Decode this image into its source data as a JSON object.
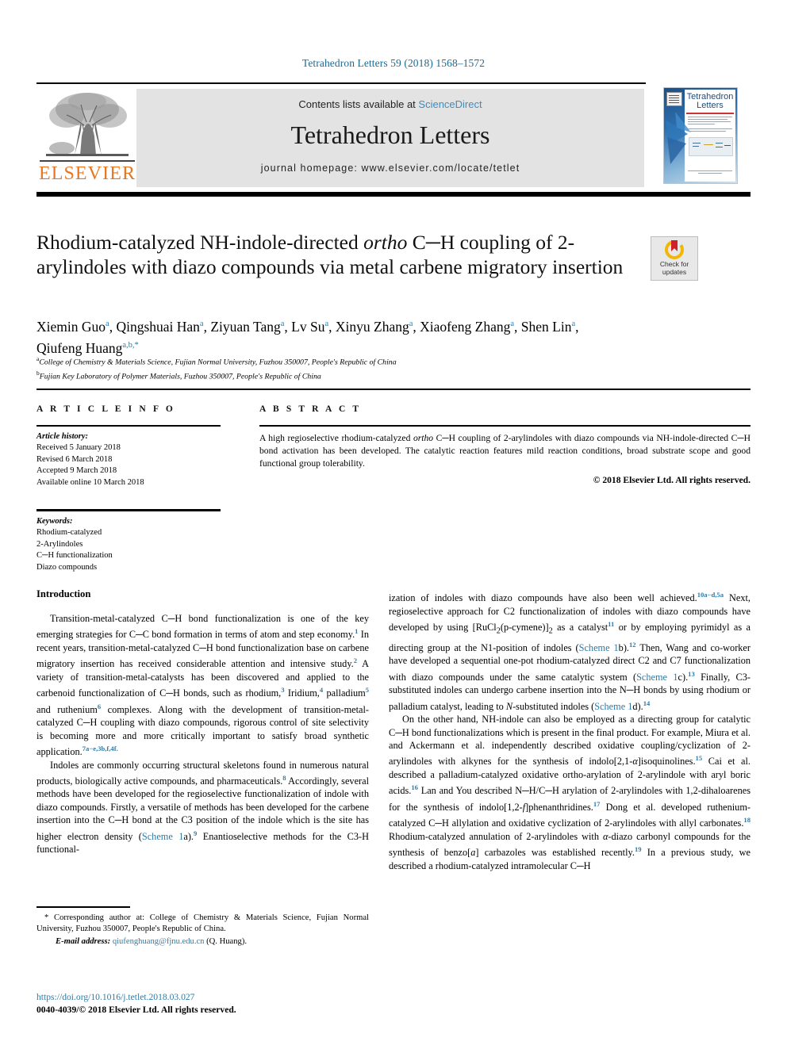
{
  "running_head": "Tetrahedron Letters 59 (2018) 1568–1572",
  "masthead": {
    "contents_prefix": "Contents lists available at ",
    "sciencedirect": "ScienceDirect",
    "journal_name": "Tetrahedron Letters",
    "homepage": "journal homepage: www.elsevier.com/locate/tetlet",
    "publisher": "ELSEVIER",
    "cover_title": "Tetrahedron Letters"
  },
  "crossmark": {
    "line1": "Check for",
    "line2": "updates"
  },
  "title": {
    "line1_a": "Rhodium-catalyzed NH-indole-directed ",
    "line1_italic": "ortho",
    "line1_b": " C─H coupling of",
    "line2": "2-arylindoles with diazo compounds via metal carbene migratory",
    "line3": "insertion"
  },
  "authors": {
    "list": [
      {
        "name": "Xiemin Guo",
        "sup": "a"
      },
      {
        "name": "Qingshuai Han",
        "sup": "a"
      },
      {
        "name": "Ziyuan Tang",
        "sup": "a"
      },
      {
        "name": "Lv Su",
        "sup": "a"
      },
      {
        "name": "Xinyu Zhang",
        "sup": "a"
      },
      {
        "name": "Xiaofeng Zhang",
        "sup": "a"
      },
      {
        "name": "Shen Lin",
        "sup": "a"
      },
      {
        "name": "Qiufeng Huang",
        "sup": "a,b,*"
      }
    ],
    "affiliation_a": "College of Chemistry & Materials Science, Fujian Normal University, Fuzhou 350007, People's Republic of China",
    "affiliation_b": "Fujian Key Laboratory of Polymer Materials, Fuzhou 350007, People's Republic of China",
    "affiliation_a_mark": "a",
    "affiliation_b_mark": "b"
  },
  "sections": {
    "article_info_header": "A R T I C L E   I N F O",
    "abstract_header": "A B S T R A C T"
  },
  "article_info": {
    "history_title": "Article history:",
    "history": [
      "Received 5 January 2018",
      "Revised 6 March 2018",
      "Accepted 9 March 2018",
      "Available online 10 March 2018"
    ],
    "keywords_title": "Keywords:",
    "keywords": [
      "Rhodium-catalyzed",
      "2-Arylindoles",
      "C─H functionalization",
      "Diazo compounds"
    ]
  },
  "abstract": {
    "part1": "A high regioselective rhodium-catalyzed ",
    "italic1": "ortho",
    "part2": " C─H coupling of 2-arylindoles with diazo compounds via NH-indole-directed C─H bond activation has been developed. The catalytic reaction features mild reaction conditions, broad substrate scope and good functional group tolerability.",
    "copyright": "© 2018 Elsevier Ltd. All rights reserved."
  },
  "body": {
    "intro_heading": "Introduction",
    "left_p1_a": "Transition-metal-catalyzed C─H bond functionalization is one of the key emerging strategies for C─C bond formation in terms of atom and step economy.",
    "left_p1_r1": "1",
    "left_p1_b": " In recent years, transition-metal-catalyzed C─H bond functionalization base on carbene migratory insertion has received considerable attention and intensive study.",
    "left_p1_r2": "2",
    "left_p1_c": " A variety of transition-metal-catalysts has been discovered and applied to the carbenoid functionalization of C─H bonds, such as rhodium,",
    "left_p1_r3": "3",
    "left_p1_d": " Iridium,",
    "left_p1_r4": "4",
    "left_p1_e": " palladium",
    "left_p1_r5": "5",
    "left_p1_f": " and ruthenium",
    "left_p1_r6": "6",
    "left_p1_g": " complexes. Along with the development of transition-metal-catalyzed C─H coupling with diazo compounds, rigorous control of site selectivity is becoming more and more critically important to satisfy broad synthetic application.",
    "left_p1_r7": "7a−e,3b,f,4f.",
    "left_p2_a": "Indoles are commonly occurring structural skeletons found in numerous natural products, biologically active compounds, and pharmaceuticals.",
    "left_p2_r1": "8",
    "left_p2_b": " Accordingly, several methods have been developed for the regioselective functionalization of indole with diazo compounds. Firstly, a versatile of methods has been developed for the carbene insertion into the C─H bond at the C3 position of the indole which is the site has higher electron density (",
    "left_p2_link": "Scheme 1",
    "left_p2_c": "a).",
    "left_p2_r2": "9",
    "left_p2_d": " Enantioselective methods for the C3-H functional-",
    "right_p1_a": "ization of indoles with diazo compounds have also been well achieved.",
    "right_p1_r1": "10a−d,5a",
    "right_p1_b": " Next, regioselective approach for C2 functionalization of indoles with diazo compounds have developed by using [RuCl",
    "right_p1_sub1": "2",
    "right_p1_c": "(p-cymene)]",
    "right_p1_sub2": "2",
    "right_p1_d": " as a catalyst",
    "right_p1_r2": "11",
    "right_p1_e": " or by employing pyrimidyl as a directing group at the N1-position of indoles (",
    "right_p1_link1": "Scheme 1",
    "right_p1_f": "b).",
    "right_p1_r3": "12",
    "right_p1_g": " Then, Wang and co-worker have developed a sequential one-pot rhodium-catalyzed direct C2 and C7 functionalization with diazo compounds under the same catalytic system (",
    "right_p1_link2": "Scheme 1",
    "right_p1_h": "c).",
    "right_p1_r4": "13",
    "right_p1_i": " Finally, C3-substituted indoles can undergo carbene insertion into the N─H bonds by using rhodium or palladium catalyst, leading to ",
    "right_p1_ital": "N",
    "right_p1_j": "-substituted indoles (",
    "right_p1_link3": "Scheme 1",
    "right_p1_k": "d).",
    "right_p1_r5": "14",
    "right_p2_a": "On the other hand, NH-indole can also be employed as a directing group for catalytic C─H bond functionalizations which is present in the final product. For example, Miura et al. and Ackermann et al. independently described oxidative coupling/cyclization of 2-arylindoles with alkynes for the synthesis of indolo[2,1-",
    "right_p2_ital1": "α",
    "right_p2_b": "]isoquinolines.",
    "right_p2_r1": "15",
    "right_p2_c": " Cai et al. described a palladium-catalyzed oxidative ortho-arylation of 2-arylindole with aryl boric acids.",
    "right_p2_r2": "16",
    "right_p2_d": " Lan and You described N─H/C─H arylation of 2-arylindoles with 1,2-dihaloarenes for the synthesis of indolo[1,2-",
    "right_p2_ital2": "f",
    "right_p2_e": "]phenanthridines.",
    "right_p2_r3": "17",
    "right_p2_f": " Dong et al. developed ruthenium-catalyzed C─H allylation and oxidative cyclization of 2-arylindoles with allyl carbonates.",
    "right_p2_r4": "18",
    "right_p2_g": " Rhodium-catalyzed annulation of 2-arylindoles with ",
    "right_p2_ital3": "α",
    "right_p2_h": "-diazo carbonyl compounds for the synthesis of benzo[",
    "right_p2_ital4": "a",
    "right_p2_i": "] carbazoles was established recently.",
    "right_p2_r5": "19",
    "right_p2_j": " In a previous study, we described a rhodium-catalyzed intramolecular C─H"
  },
  "footnote": {
    "star": "*",
    "corresponding_a": " Corresponding author at: College of Chemistry & Materials Science, Fujian Normal University, Fuzhou 350007, People's Republic of China.",
    "email_label": "E-mail address:",
    "email": "qiufenghuang@fjnu.edu.cn",
    "email_owner": " (Q. Huang)."
  },
  "footer": {
    "doi": "https://doi.org/10.1016/j.tetlet.2018.03.027",
    "issn": "0040-4039/© 2018 Elsevier Ltd. All rights reserved."
  },
  "colors": {
    "link": "#2f7aa6",
    "running_head": "#1b6a94",
    "elsevier_orange": "#E87722",
    "band_gray": "#e3e3e3"
  }
}
